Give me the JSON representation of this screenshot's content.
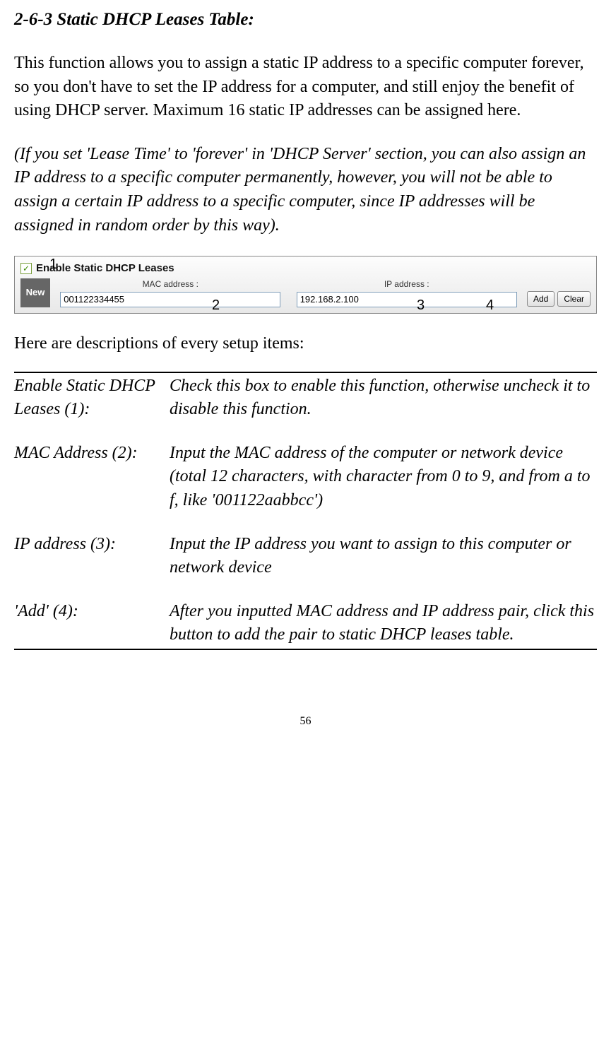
{
  "heading": "2-6-3 Static DHCP Leases Table:",
  "para1": "This function allows you to assign a static IP address to a specific computer forever, so you don't have to set the IP address for a computer, and still enjoy the benefit of using DHCP server. Maximum 16 static IP addresses can be assigned here.",
  "para2": "(If you set 'Lease Time' to 'forever' in 'DHCP Server' section, you can also assign an IP address to a specific computer permanently, however, you will not be able to assign a certain IP address to a specific computer, since IP addresses will be assigned in random order by this way).",
  "figure": {
    "callouts": {
      "c1": "1",
      "c2": "2",
      "c3": "3",
      "c4": "4"
    },
    "checkbox_checked": "✓",
    "panel_title": "Enable Static DHCP Leases",
    "new_label": "New",
    "mac_label": "MAC address :",
    "ip_label": "IP address :",
    "mac_value": "001122334455",
    "ip_value": "192.168.2.100",
    "add_btn": "Add",
    "clear_btn": "Clear"
  },
  "intro2": "Here are descriptions of every setup items:",
  "rows": [
    {
      "term": "Enable Static DHCP Leases (1):",
      "def": "Check this box to enable this function, otherwise uncheck it to disable this function."
    },
    {
      "term": "MAC Address (2):",
      "def": "Input the MAC address of the computer or network device (total 12 characters, with character from 0 to 9, and from a to f, like '001122aabbcc')"
    },
    {
      "term": "IP address (3):",
      "def": "Input the IP address you want to assign to this computer or network device"
    },
    {
      "term": "'Add' (4):",
      "def": "After you inputted MAC address and IP address pair, click this button to add the pair to static DHCP leases table."
    }
  ],
  "pagenum": "56"
}
